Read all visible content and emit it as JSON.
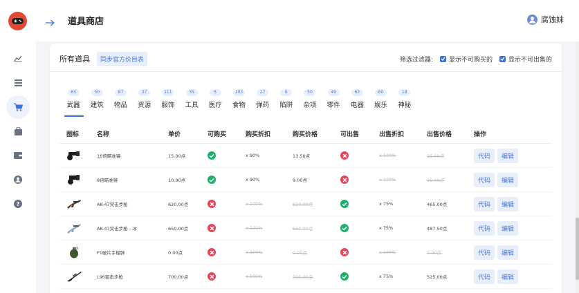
{
  "header": {
    "title": "道具商店",
    "user_name": "腐蚀妹"
  },
  "card": {
    "title": "所有道具",
    "sync_label": "同步官方价目表"
  },
  "filter": {
    "label": "筛选过滤器:",
    "opt1": "显示不可购买的",
    "opt2": "显示不可出售的"
  },
  "categories": [
    {
      "name": "武器",
      "count": "63"
    },
    {
      "name": "建筑",
      "count": "50"
    },
    {
      "name": "物品",
      "count": "87"
    },
    {
      "name": "资源",
      "count": "37"
    },
    {
      "name": "服饰",
      "count": "111"
    },
    {
      "name": "工具",
      "count": "35"
    },
    {
      "name": "医疗",
      "count": "5"
    },
    {
      "name": "食物",
      "count": "103"
    },
    {
      "name": "弹药",
      "count": "27"
    },
    {
      "name": "陷阱",
      "count": "6"
    },
    {
      "name": "杂项",
      "count": "50"
    },
    {
      "name": "零件",
      "count": "49"
    },
    {
      "name": "电器",
      "count": "62"
    },
    {
      "name": "娱乐",
      "count": "60"
    },
    {
      "name": "神秘",
      "count": "18"
    }
  ],
  "columns": {
    "icon": "图标",
    "name": "名称",
    "price": "单价",
    "buyable": "可购买",
    "buy_discount": "购买折扣",
    "buy_price": "购买价格",
    "sellable": "可出售",
    "sell_discount": "出售折扣",
    "sell_price": "出售价格",
    "actions": "操作"
  },
  "actions": {
    "code": "代码",
    "edit": "编辑"
  },
  "rows": [
    {
      "name": "16倍瞄准镜",
      "price": "15.00点",
      "buyable": true,
      "buy_discount": "x 90%",
      "buy_price": "13.50点",
      "sellable": false,
      "sell_discount": "x 100%",
      "sell_price": "15.00点"
    },
    {
      "name": "8倍瞄准镜",
      "price": "10.00点",
      "buyable": true,
      "buy_discount": "x 90%",
      "buy_price": "9.00点",
      "sellable": false,
      "sell_discount": "x 100%",
      "sell_price": "10.00点"
    },
    {
      "name": "AK-47突击步枪",
      "price": "620.00点",
      "buyable": false,
      "buy_discount": "x 100%",
      "buy_price": "620.00点",
      "sellable": true,
      "sell_discount": "x 75%",
      "sell_price": "465.00点"
    },
    {
      "name": "AK-47突击步枪 - 冰",
      "price": "650.00点",
      "buyable": false,
      "buy_discount": "x 100%",
      "buy_price": "650.00点",
      "sellable": true,
      "sell_discount": "x 75%",
      "sell_price": "487.50点"
    },
    {
      "name": "F1破片手榴弹",
      "price": "0.00点",
      "buyable": false,
      "buy_discount": "x 100%",
      "buy_price": "0.00点",
      "sellable": false,
      "sell_discount": "x 100%",
      "sell_price": "0.00点"
    },
    {
      "name": "L96狙击步枪",
      "price": "700.00点",
      "buyable": false,
      "buy_discount": "x 100%",
      "buy_price": "700.00点",
      "sellable": true,
      "sell_discount": "x 75%",
      "sell_price": "525.00点"
    }
  ]
}
